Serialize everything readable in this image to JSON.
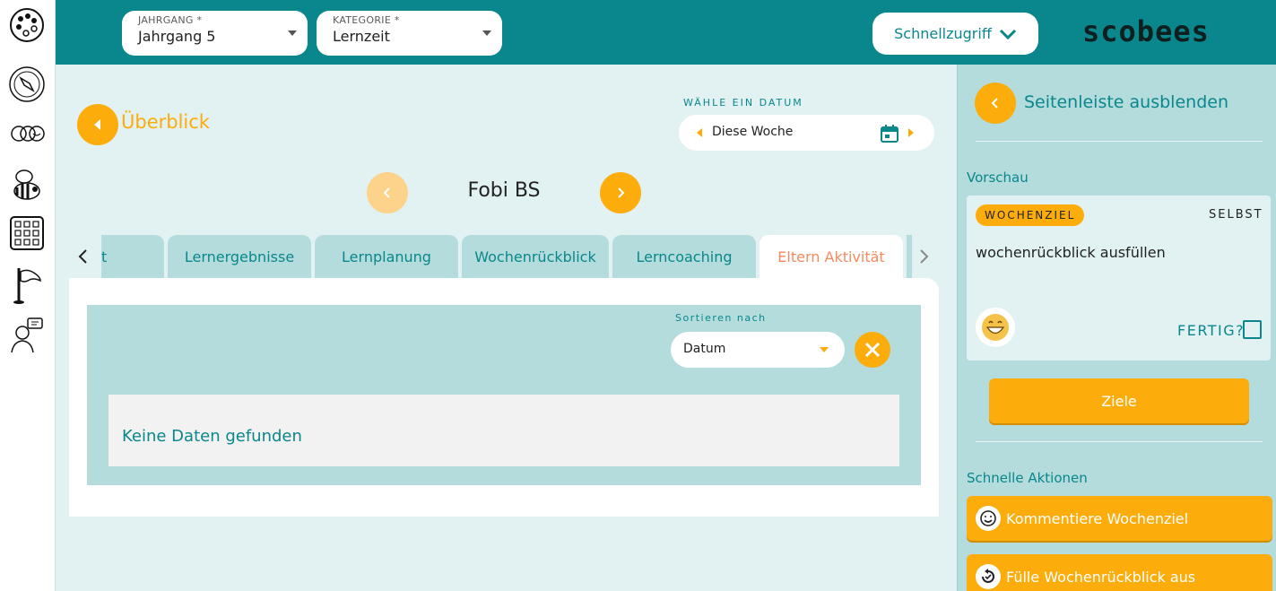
{
  "header": {
    "year_select": {
      "label": "JAHRGANG *",
      "value": "Jahrgang 5"
    },
    "category_select": {
      "label": "KATEGORIE *",
      "value": "Lernzeit"
    },
    "quick_access": "Schnellzugriff",
    "logo": "scobees"
  },
  "nav": {
    "back_label": "Überblick",
    "date_caption": "WÄHLE EIN DATUM",
    "date_value": "Diese Woche",
    "student_name": "Fobi BS"
  },
  "tabs": [
    {
      "label": "t"
    },
    {
      "label": "Lernergebnisse"
    },
    {
      "label": "Lernplanung"
    },
    {
      "label": "Wochenrückblick"
    },
    {
      "label": "Lerncoaching"
    },
    {
      "label": "Eltern Aktivität"
    }
  ],
  "content": {
    "sort_caption": "Sortieren nach",
    "sort_value": "Datum",
    "empty_message": "Keine Daten gefunden"
  },
  "sidebar": {
    "hide_label": "Seitenleiste ausblenden",
    "preview_title": "Vorschau",
    "badge": "WOCHENZIEL",
    "owner": "SELBST",
    "goal_text": "wochenrückblick ausfüllen",
    "done_label": "FERTIG?",
    "goals_button": "Ziele",
    "quick_actions_title": "Schnelle Aktionen",
    "actions": [
      {
        "label": "Kommentiere Wochenziel"
      },
      {
        "label": "Fülle Wochenrückblick aus"
      }
    ]
  },
  "colors": {
    "teal": "#09878c",
    "orange": "#fcac0b",
    "light_teal": "#b4dcdd",
    "background": "#e2f1f1",
    "active_tab_text": "#fa8a5e"
  }
}
